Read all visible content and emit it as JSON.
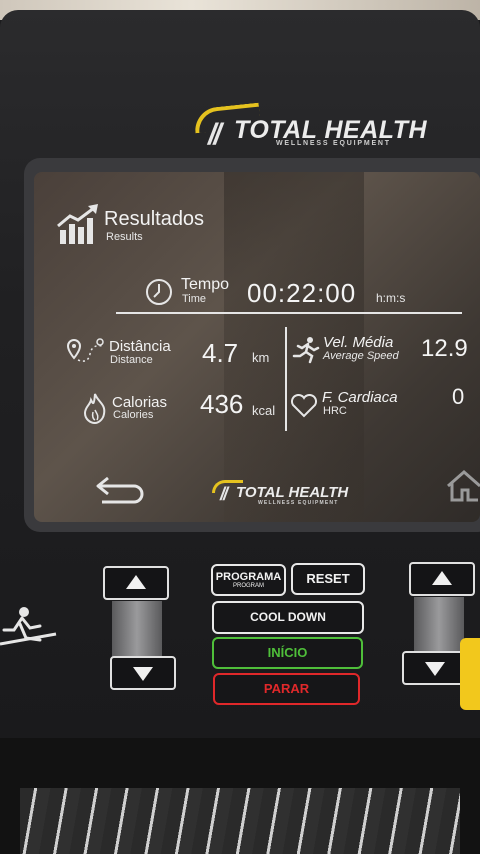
{
  "brand": {
    "name": "TOTAL HEALTH",
    "tagline": "WELLNESS EQUIPMENT",
    "accent": "#e5c21f"
  },
  "screen": {
    "header": {
      "title": "Resultados",
      "subtitle": "Results",
      "icon": "bar-chart-rising-icon"
    },
    "time": {
      "label": "Tempo",
      "sublabel": "Time",
      "value": "00:22:00",
      "unit": "h:m:s",
      "icon": "clock-icon"
    },
    "distance": {
      "label": "Distância",
      "sublabel": "Distance",
      "value": "4.7",
      "unit": "km",
      "icon": "map-pin-route-icon"
    },
    "speed": {
      "label": "Vel. Média",
      "sublabel": "Average Speed",
      "value": "12.9",
      "icon": "runner-icon"
    },
    "calories": {
      "label": "Calorias",
      "sublabel": "Calories",
      "value": "436",
      "unit": "kcal",
      "icon": "flame-icon"
    },
    "heart": {
      "label": "F. Cardiaca",
      "sublabel": "HRC",
      "value": "0",
      "icon": "heart-icon"
    },
    "footer_logo": {
      "name": "TOTAL HEALTH",
      "tagline": "WELLNESS EQUIPMENT"
    }
  },
  "buttons": {
    "programa": {
      "label": "PROGRAMA",
      "sub": "PROGRAM"
    },
    "reset": {
      "label": "RESET"
    },
    "cooldown": {
      "label": "COOL DOWN"
    },
    "inicio": {
      "label": "INÍCIO",
      "color": "#4fbf3a"
    },
    "parar": {
      "label": "PARAR",
      "color": "#e0282a"
    }
  }
}
